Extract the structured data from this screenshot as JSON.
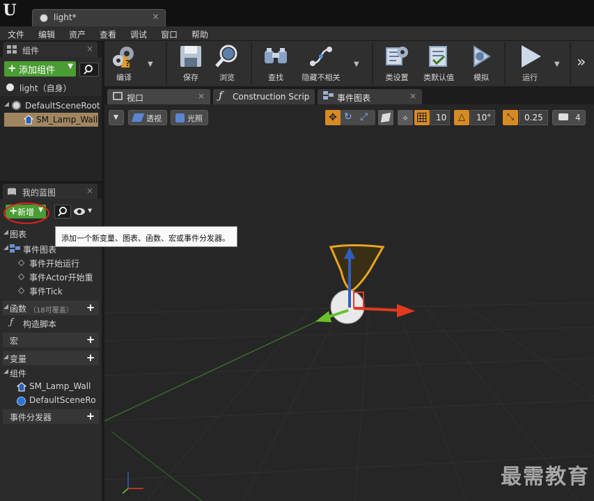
{
  "window": {
    "logo_text": "U",
    "document_tab": "light*",
    "tab_close": "×"
  },
  "menu": [
    "文件",
    "编辑",
    "资产",
    "查看",
    "调试",
    "窗口",
    "帮助"
  ],
  "components_panel": {
    "title": "组件",
    "close": "×",
    "add_button": "添加组件",
    "self_label": "light（自身）",
    "tree": [
      {
        "label": "DefaultSceneRoot",
        "selected": false
      },
      {
        "label": "SM_Lamp_Wall",
        "selected": true
      }
    ]
  },
  "blueprint_panel": {
    "title": "我的蓝图",
    "close": "×",
    "new_button": "新增",
    "graphs_label": "图表",
    "event_graph": "事件图表",
    "events": [
      "事件开始运行",
      "事件Actor开始重",
      "事件Tick"
    ],
    "functions_label": "函数",
    "functions_note": "（18可覆盖）",
    "construction_script": "构造脚本",
    "macros_label": "宏",
    "variables_label": "变量",
    "components_label": "组件",
    "component_vars": [
      "SM_Lamp_Wall",
      "DefaultSceneRo"
    ],
    "dispatchers_label": "事件分发器"
  },
  "tooltip": "添加一个新变量、图表、函数、宏或事件分发器。",
  "toolbar": {
    "buttons": [
      {
        "label": "编译",
        "icon": "compile-icon"
      },
      {
        "label": "保存",
        "icon": "save-icon"
      },
      {
        "label": "浏览",
        "icon": "browse-icon"
      },
      {
        "label": "查找",
        "icon": "find-icon"
      },
      {
        "label": "隐藏不相关",
        "icon": "hide-unrelated-icon"
      },
      {
        "label": "类设置",
        "icon": "class-settings-icon"
      },
      {
        "label": "类默认值",
        "icon": "class-defaults-icon"
      },
      {
        "label": "模拟",
        "icon": "simulate-icon"
      },
      {
        "label": "运行",
        "icon": "play-icon"
      }
    ],
    "overflow": "»"
  },
  "editor_tabs": [
    {
      "label": "视口",
      "active": true
    },
    {
      "label": "Construction Scrip",
      "active": false
    },
    {
      "label": "事件图表",
      "active": false
    }
  ],
  "viewport": {
    "perspective": "透视",
    "lit": "光照",
    "grid_snap": "10",
    "rotation_snap": "10°",
    "scale_snap": "0.25",
    "camera_speed": "4",
    "watermark": "最需教育"
  },
  "colors": {
    "accent_green": "#4a9d33",
    "accent_orange": "#d88a24",
    "selection": "#a08660",
    "axis_x": "#e23a1e",
    "axis_y": "#6ac02a",
    "axis_z": "#2f5fbd"
  }
}
